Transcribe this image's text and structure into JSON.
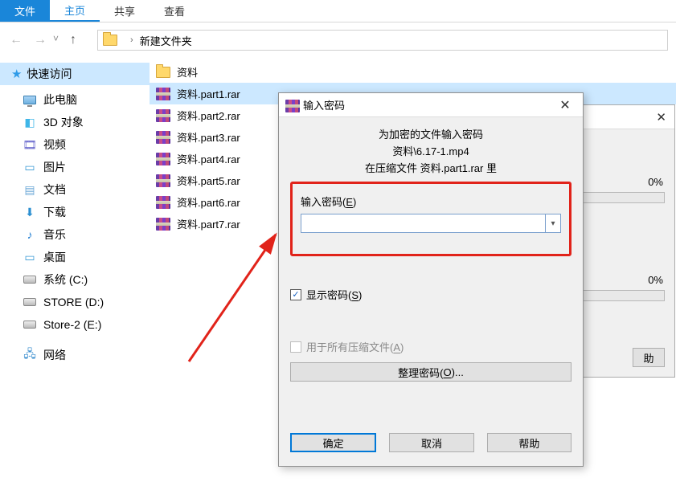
{
  "ribbon": {
    "file": "文件",
    "home": "主页",
    "share": "共享",
    "view": "查看"
  },
  "addressbar": {
    "folder": "新建文件夹"
  },
  "sidebar": {
    "quick_access": "快速访问",
    "this_pc": "此电脑",
    "objects3d": "3D 对象",
    "videos": "视频",
    "pictures": "图片",
    "documents": "文档",
    "downloads": "下载",
    "music": "音乐",
    "desktop": "桌面",
    "drive_c": "系统 (C:)",
    "drive_d": "STORE (D:)",
    "drive_e": "Store-2 (E:)",
    "network": "网络"
  },
  "files": {
    "folder": "资料",
    "items": [
      "资料.part1.rar",
      "资料.part2.rar",
      "资料.part3.rar",
      "资料.part4.rar",
      "资料.part5.rar",
      "资料.part6.rar",
      "资料.part7.rar"
    ]
  },
  "bg_dialog": {
    "pct": "0%",
    "help": "助"
  },
  "pwd_dialog": {
    "title": "输入密码",
    "line1": "为加密的文件输入密码",
    "line2": "资料\\6.17-1.mp4",
    "line3": "在压缩文件 资料.part1.rar 里",
    "input_label_pre": "输入密码(",
    "input_label_key": "E",
    "input_label_post": ")",
    "show_pwd_pre": "显示密码(",
    "show_pwd_key": "S",
    "show_pwd_post": ")",
    "all_files_pre": "用于所有压缩文件(",
    "all_files_key": "A",
    "all_files_post": ")",
    "organize_pre": "整理密码(",
    "organize_key": "O",
    "organize_post": ")...",
    "ok": "确定",
    "cancel": "取消",
    "help": "帮助"
  }
}
